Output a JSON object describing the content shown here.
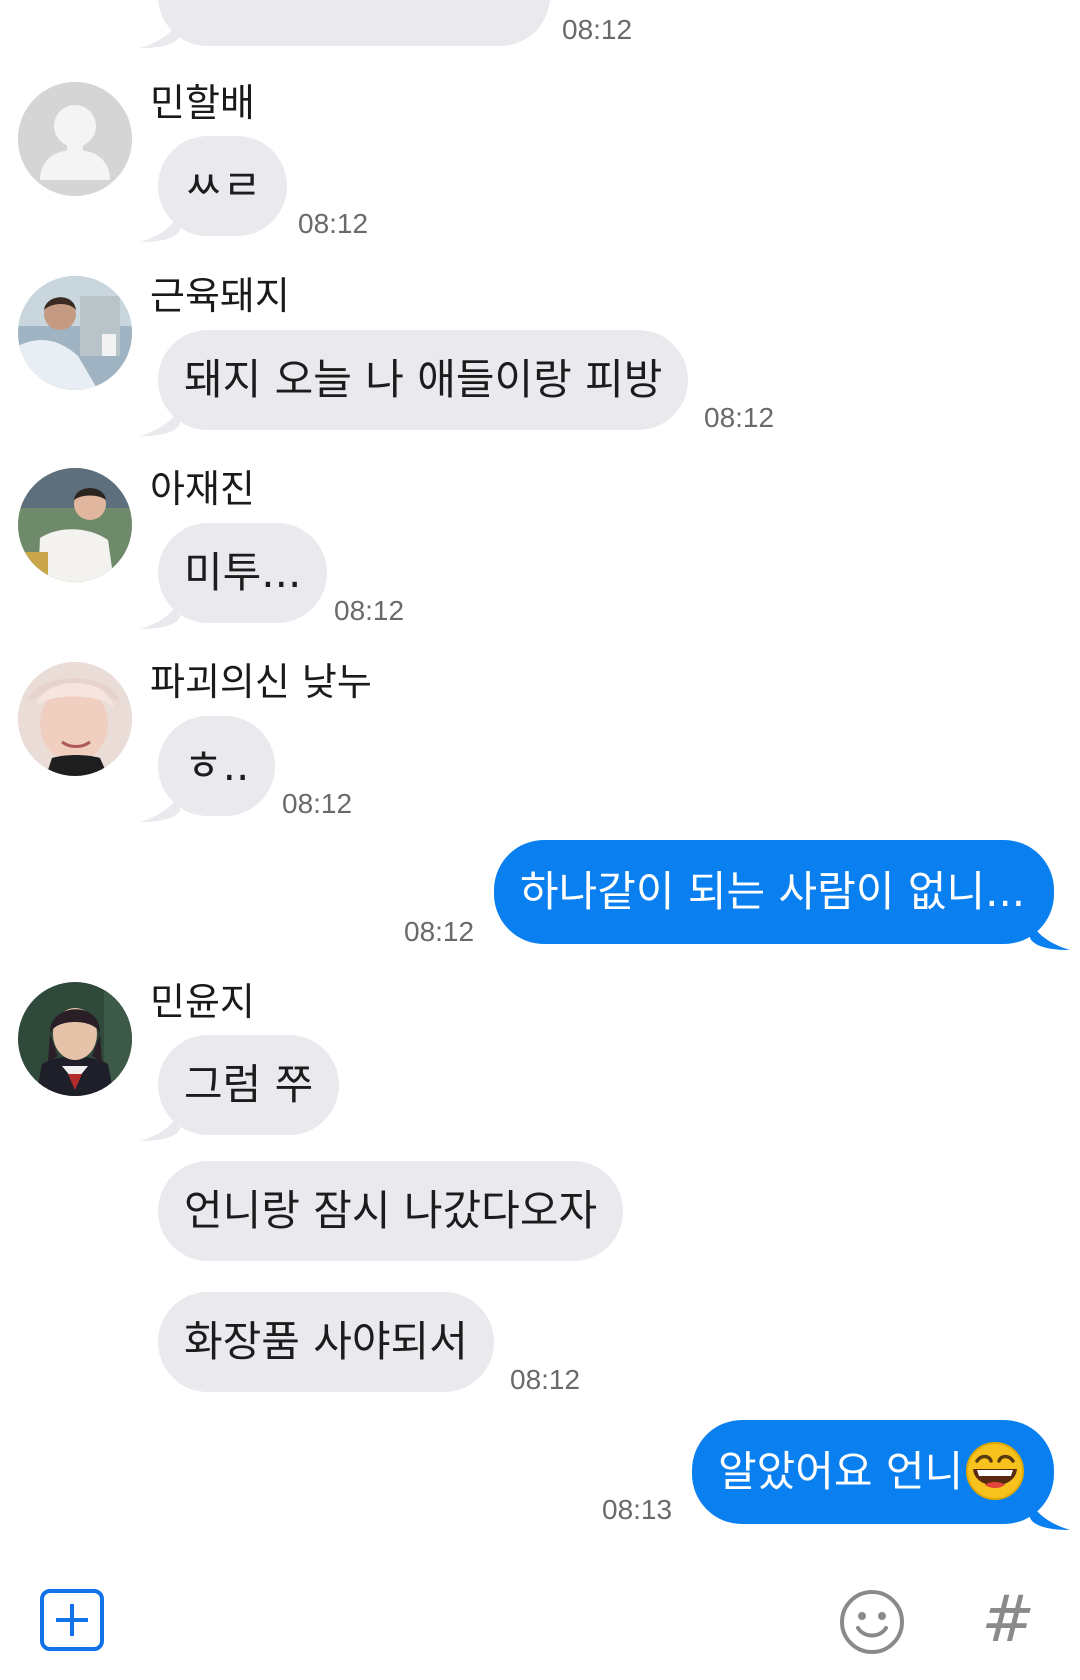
{
  "messages": [
    {
      "sender": "",
      "text": "",
      "time": "08:12"
    },
    {
      "sender": "민할배",
      "text": "ㅆㄹ",
      "time": "08:12"
    },
    {
      "sender": "근육돼지",
      "text": "돼지 오늘 나 애들이랑 피방",
      "time": "08:12"
    },
    {
      "sender": "아재진",
      "text": "미투...",
      "time": "08:12"
    },
    {
      "sender": "파괴의신 낮누",
      "text": "ㅎ..",
      "time": "08:12"
    },
    {
      "sender": "me",
      "text": "하나같이 되는 사람이 없니...",
      "time": "08:12"
    },
    {
      "sender": "민윤지",
      "text": "그럼 쭈",
      "time": ""
    },
    {
      "sender": "민윤지",
      "text": "언니랑 잠시 나갔다오자",
      "time": ""
    },
    {
      "sender": "민윤지",
      "text": "화장품 사야되서",
      "time": "08:12"
    },
    {
      "sender": "me",
      "text": "알았어요 언니",
      "time": "08:13",
      "emoji": "grinning-face-emoji"
    }
  ],
  "toolbar": {
    "add_icon": "plus-square-icon",
    "emoji_icon": "smiley-icon",
    "hashtag_label": "#"
  },
  "colors": {
    "incoming_bubble": "#e9e9ee",
    "outgoing_bubble": "#0a7ff0",
    "accent": "#1273e8"
  }
}
